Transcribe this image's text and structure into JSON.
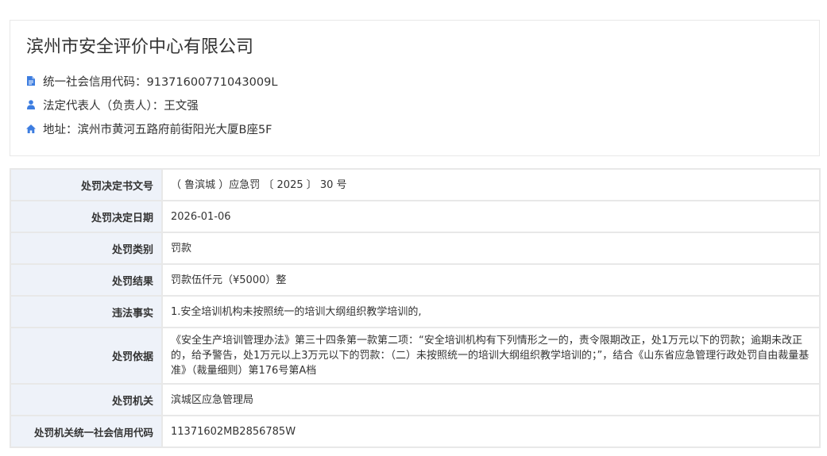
{
  "company": {
    "name": "滨州市安全评价中心有限公司",
    "credit_code": "统一社会信用代码：91371600771043009L",
    "legal_rep": "法定代表人（负责人）：王文强",
    "address": "地址：滨州市黄河五路府前街阳光大厦B座5F",
    "icons": [
      "document-icon",
      "user-icon",
      "home-icon"
    ],
    "icon_color": "#3d7de0"
  },
  "penalty": {
    "rows": [
      {
        "label": "处罚决定书文号",
        "value": "（ 鲁滨城 ）应急罚 〔 2025 〕 30 号"
      },
      {
        "label": "处罚决定日期",
        "value": "2026-01-06"
      },
      {
        "label": "处罚类别",
        "value": "罚款"
      },
      {
        "label": "处罚结果",
        "value": "罚款伍仟元（¥5000）整"
      },
      {
        "label": "违法事实",
        "value": "1.安全培训机构未按照统一的培训大纲组织教学培训的,"
      },
      {
        "label": "处罚依据",
        "value": "《安全生产培训管理办法》第三十四条第一款第二项：“安全培训机构有下列情形之一的，责令限期改正，处1万元以下的罚款；逾期未改正的，给予警告，处1万元以上3万元以下的罚款：（二）未按照统一的培训大纲组织教学培训的；”，结合《山东省应急管理行政处罚自由裁量基准》（裁量细则）第176号第A档"
      },
      {
        "label": "处罚机关",
        "value": "滨城区应急管理局"
      },
      {
        "label": "处罚机关统一社会信用代码",
        "value": "11371602MB2856785W"
      }
    ]
  }
}
